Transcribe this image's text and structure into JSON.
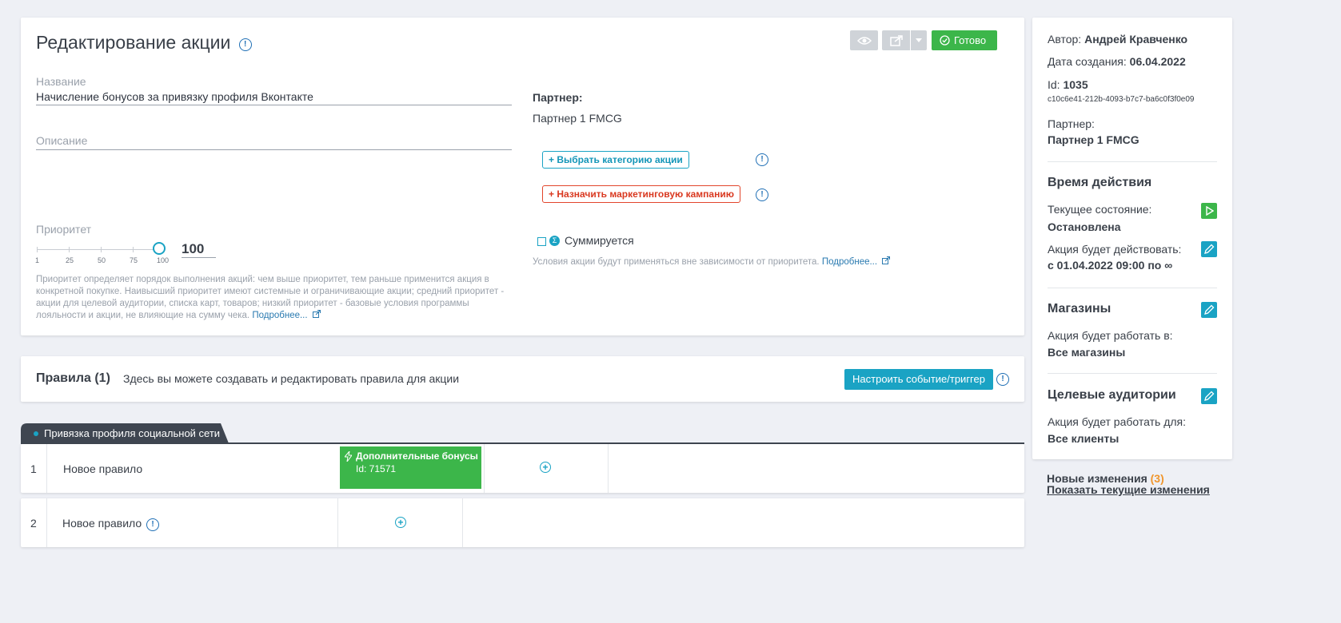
{
  "header": {
    "title": "Редактирование акции",
    "done_label": "Готово"
  },
  "form": {
    "name_label": "Название",
    "name_value": "Начисление бонусов за привязку профиля Вконтакте",
    "description_label": "Описание",
    "priority_label": "Приоритет",
    "priority_value": "100",
    "priority_ticks": [
      "1",
      "25",
      "50",
      "75",
      "100"
    ],
    "priority_hint": "Приоритет определяет порядок выполнения акций: чем выше приоритет, тем раньше применится акция в конкретной покупке. Наивысший приоритет имеют системные и ограничивающие акции; средний приоритет - акции для целевой аудитории, списка карт, товаров; низкий приоритет - базовые условия программы лояльности и акции, не влияющие на сумму чека.",
    "more_link": "Подробнее..."
  },
  "partner_block": {
    "label": "Партнер:",
    "value": "Партнер 1 FMCG",
    "choose_category": "+ Выбрать категорию акции",
    "assign_campaign": "+ Назначить маркетинговую кампанию",
    "summable_label": "Суммируется",
    "summable_hint": "Условия акции будут применяться вне зависимости от приоритета.",
    "more_link": "Подробнее..."
  },
  "rules": {
    "title": "Правила (1)",
    "description": "Здесь вы можете создавать и редактировать правила для акции",
    "trigger_button": "Настроить событие/триггер",
    "tab_label": "Привязка профиля социальной сети",
    "rows": [
      {
        "num": "1",
        "name": "Новое правило",
        "action_title": "Дополнительные бонусы",
        "action_id": "Id: 71571"
      },
      {
        "num": "2",
        "name": "Новое правило"
      }
    ]
  },
  "sidebar": {
    "author_label": "Автор:",
    "author_value": "Андрей Кравченко",
    "created_label": "Дата создания:",
    "created_value": "06.04.2022",
    "id_label": "Id:",
    "id_value": "1035",
    "guid": "c10c6e41-212b-4093-b7c7-ba6c0f3f0e09",
    "partner_label": "Партнер:",
    "partner_value": "Партнер 1 FMCG",
    "time_title": "Время действия",
    "state_label": "Текущее состояние:",
    "state_value": "Остановлена",
    "period_label": "Акция будет действовать:",
    "period_value": "с 01.04.2022 09:00 по ∞",
    "stores_title": "Магазины",
    "stores_label": "Акция будет работать в:",
    "stores_value": "Все магазины",
    "audience_title": "Целевые аудитории",
    "audience_label": "Акция будет работать для:",
    "audience_value": "Все клиенты"
  },
  "changes": {
    "label": "Новые изменения",
    "count": "(3)",
    "show_link": "Показать текущие изменения"
  },
  "colors": {
    "accent": "#1aa3c4",
    "success": "#3cb64a",
    "danger": "#e2452b",
    "link": "#2a7ab0"
  }
}
